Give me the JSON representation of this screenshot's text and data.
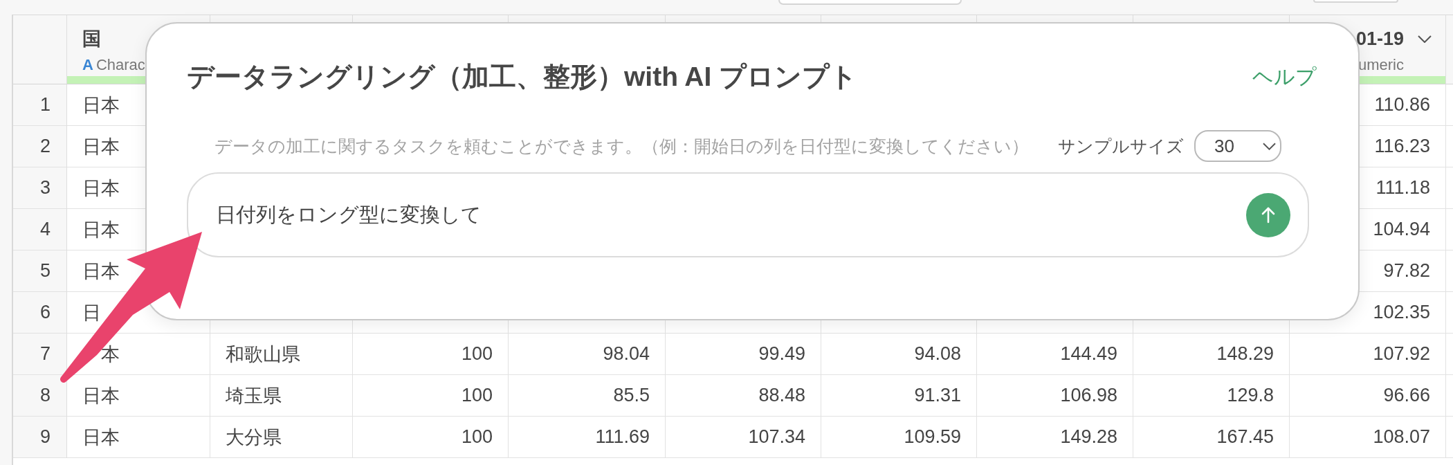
{
  "table": {
    "columns": [
      {
        "kind": "text",
        "name": "国",
        "type_icon": "A",
        "type": "Charac",
        "level": 1,
        "menu": false
      },
      {
        "kind": "text"
      },
      {
        "kind": "number"
      },
      {
        "kind": "number"
      },
      {
        "kind": "number"
      },
      {
        "kind": "number"
      },
      {
        "kind": "number"
      },
      {
        "kind": "number"
      },
      {
        "kind": "number",
        "name": "01-19",
        "type": "umeric",
        "level": 1,
        "menu": true
      }
    ],
    "rows": [
      {
        "number": "1",
        "first_cell_covered": false,
        "cells": [
          "日本",
          null,
          null,
          null,
          null,
          null,
          null,
          null,
          "110.86"
        ]
      },
      {
        "number": "2",
        "first_cell_covered": false,
        "cells": [
          "日本",
          null,
          null,
          null,
          null,
          null,
          null,
          null,
          "116.23"
        ]
      },
      {
        "number": "3",
        "first_cell_covered": false,
        "cells": [
          "日本",
          null,
          null,
          null,
          null,
          null,
          null,
          null,
          "111.18"
        ]
      },
      {
        "number": "4",
        "first_cell_covered": false,
        "cells": [
          "日本",
          null,
          null,
          null,
          null,
          null,
          null,
          null,
          "104.94"
        ]
      },
      {
        "number": "5",
        "first_cell_covered": false,
        "cells": [
          "日本",
          null,
          null,
          null,
          null,
          null,
          null,
          null,
          "97.82"
        ]
      },
      {
        "number": "6",
        "first_cell_covered": false,
        "cells": [
          "日",
          null,
          null,
          null,
          null,
          null,
          null,
          null,
          "102.35"
        ]
      },
      {
        "number": "7",
        "first_cell_covered": true,
        "cells": [
          "本",
          "和歌山県",
          "100",
          "98.04",
          "99.49",
          "94.08",
          "144.49",
          "148.29",
          "107.92"
        ]
      },
      {
        "number": "8",
        "first_cell_covered": false,
        "cells": [
          "日本",
          "埼玉県",
          "100",
          "85.5",
          "88.48",
          "91.31",
          "106.98",
          "129.8",
          "96.66"
        ]
      },
      {
        "number": "9",
        "first_cell_covered": false,
        "cells": [
          "日本",
          "大分県",
          "100",
          "111.69",
          "107.34",
          "109.59",
          "149.28",
          "167.45",
          "108.07"
        ]
      }
    ]
  },
  "dialog": {
    "title": "データラングリング（加工、整形）with AI プロンプト",
    "help_link": "ヘルプ",
    "description": "データの加工に関するタスクを頼むことができます。（例：開始日の列を日付型に変換してください）",
    "sample_size": {
      "label": "サンプルサイズ",
      "value": "30"
    },
    "prompt": {
      "value": "日付列をロング型に変換して"
    }
  }
}
